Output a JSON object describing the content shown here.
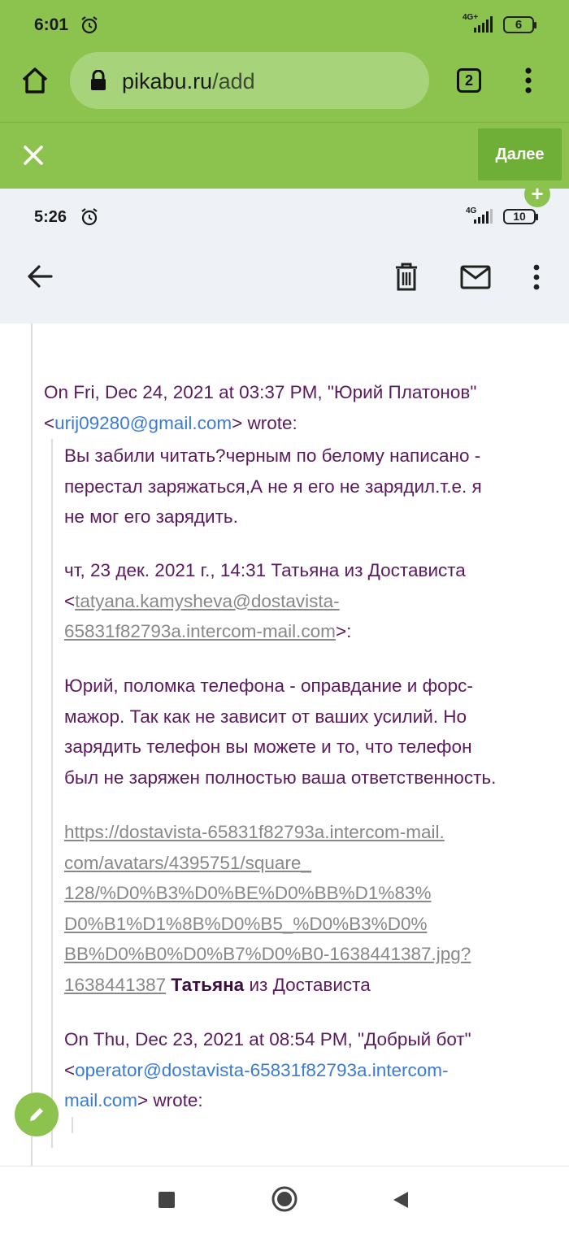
{
  "outer_status": {
    "time": "6:01",
    "network": "4G+",
    "battery": "6"
  },
  "browser": {
    "url_host": "pikabu.ru",
    "url_path": "/add",
    "tab_count": "2"
  },
  "post_editor": {
    "next_label": "Далее"
  },
  "inner_status": {
    "time": "5:26",
    "network": "4G",
    "battery": "10"
  },
  "email": {
    "header_1": {
      "line1": "On Fri, Dec 24, 2021 at 03:37 PM, \"Юрий Платонов\"",
      "email_lt": "<",
      "email": "urij09280@gmail.com",
      "email_gt": ">",
      "wrote": " wrote:"
    },
    "reply_1": [
      "Вы забили читать?черным по белому написано -",
      "перестал заряжаться,А не я его не зарядил.т.е. я",
      "не мог его зарядить."
    ],
    "header_2": {
      "line1": "чт, 23 дек. 2021 г., 14:31 Татьяна из Достависта",
      "email_lt": "<",
      "email_part1": "tatyana.kamysheva@dostavista-",
      "email_part2": "65831f82793a.intercom-mail.com",
      "email_gt": ">:"
    },
    "reply_2": [
      "Юрий, поломка телефона - оправдание и форс-",
      "мажор. Так как не зависит от ваших усилий. Но",
      "зарядить телефон вы можете и то, что телефон",
      "был не заряжен полностью ваша ответственность."
    ],
    "avatar_link": [
      "https://dostavista-65831f82793a.intercom-mail.",
      "com/avatars/4395751/square_",
      "128/%D0%B3%D0%BE%D0%BB%D1%83%",
      "D0%B1%D1%8B%D0%B5_%D0%B3%D0%",
      "BB%D0%B0%D0%B7%D0%B0-1638441387.jpg?",
      "1638441387"
    ],
    "signature_bold": "Татьяна",
    "signature_rest": " из Достависта",
    "header_3": {
      "line1": "On Thu, Dec 23, 2021 at 08:54 PM, \"Добрый бот\"",
      "email_lt": "<",
      "email_part1": "operator@dostavista-65831f82793a.intercom-",
      "email_part2": "mail.com",
      "email_gt": ">",
      "wrote": " wrote:"
    }
  }
}
